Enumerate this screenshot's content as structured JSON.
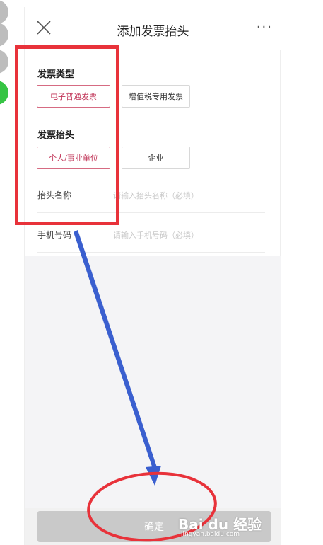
{
  "nav": {
    "title": "添加发票抬头",
    "more": "···"
  },
  "invoice_type": {
    "label": "发票类型",
    "options": [
      "电子普通发票",
      "增值税专用发票"
    ],
    "selected": "电子普通发票"
  },
  "invoice_header": {
    "label": "发票抬头",
    "options": [
      "个人/事业单位",
      "企业"
    ],
    "selected": "个人/事业单位"
  },
  "fields": [
    {
      "label": "抬头名称",
      "placeholder": "请输入抬头名称（必填）"
    },
    {
      "label": "手机号码",
      "placeholder": "请输入手机号码（必填）"
    }
  ],
  "confirm_label": "确定",
  "watermark": {
    "text": "Bai du 经验",
    "sub": "jingyan.baidu.com"
  },
  "colors": {
    "annotation_red": "#e8323a",
    "arrow_blue": "#3a5fcf",
    "selected_pink": "#c2375a",
    "step_green": "#36c444"
  }
}
